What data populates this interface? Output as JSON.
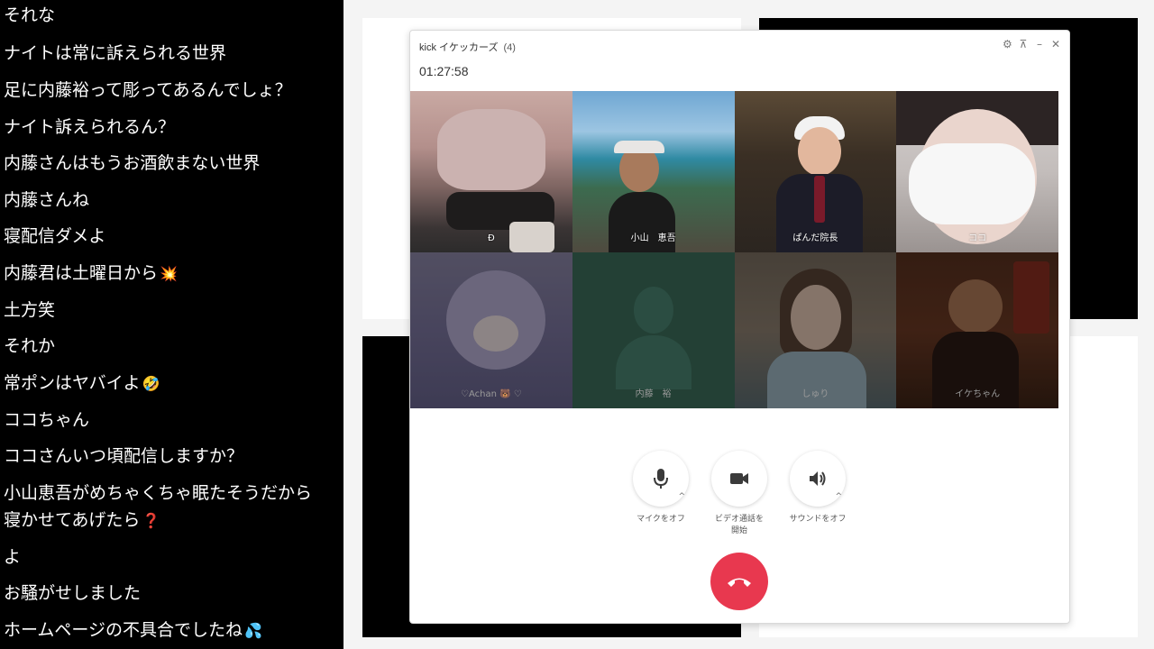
{
  "chat": {
    "messages": [
      {
        "text": "それな"
      },
      {
        "text": "ナイトは常に訴えられる世界"
      },
      {
        "text": "足に内藤裕って彫ってあるんでしょ？"
      },
      {
        "text": "ナイト訴えられるん？"
      },
      {
        "text": "内藤さんはもうお酒飲まない世界"
      },
      {
        "text": "内藤さんね"
      },
      {
        "text": "寝配信ダメよ"
      },
      {
        "text": "内藤君は土曜日から",
        "emoji": "💥"
      },
      {
        "text": "土方笑"
      },
      {
        "text": "それか"
      },
      {
        "text": "常ポンはヤバイよ",
        "emoji": "🤣"
      },
      {
        "text": "ココちゃん"
      },
      {
        "text": "ココさんいつ頃配信しますか？"
      },
      {
        "text": "小山恵吾がめちゃくちゃ眠たそうだから"
      },
      {
        "text": "寝かせてあげたら",
        "emoji": "❓"
      },
      {
        "text": "よ"
      },
      {
        "text": "お騒がせしました"
      },
      {
        "text": "ホームページの不具合でしたね",
        "emoji": "💦"
      }
    ]
  },
  "call": {
    "title": "kick イケッカーズ",
    "member_count": "(4)",
    "timer": "01:27:58",
    "window_controls": {
      "settings_icon": "gear-icon",
      "pin_icon": "pin-icon",
      "minimize_icon": "minimize-icon",
      "close_icon": "close-icon"
    },
    "participants": [
      {
        "name": "Ð",
        "video_on": true
      },
      {
        "name": "小山　恵吾",
        "video_on": true
      },
      {
        "name": "ぱんだ院長",
        "video_on": true
      },
      {
        "name": "ココ",
        "video_on": true
      },
      {
        "name": "♡Achan 🐻 ♡",
        "video_on": false
      },
      {
        "name": "内藤　裕",
        "video_on": false
      },
      {
        "name": "しゅり",
        "video_on": false
      },
      {
        "name": "イケちゃん",
        "video_on": false
      }
    ],
    "controls": {
      "mic_label": "マイクをオフ",
      "video_label": "ビデオ通話を\n開始",
      "sound_label": "サウンドをオフ"
    },
    "colors": {
      "hangup": "#e8384f"
    }
  }
}
